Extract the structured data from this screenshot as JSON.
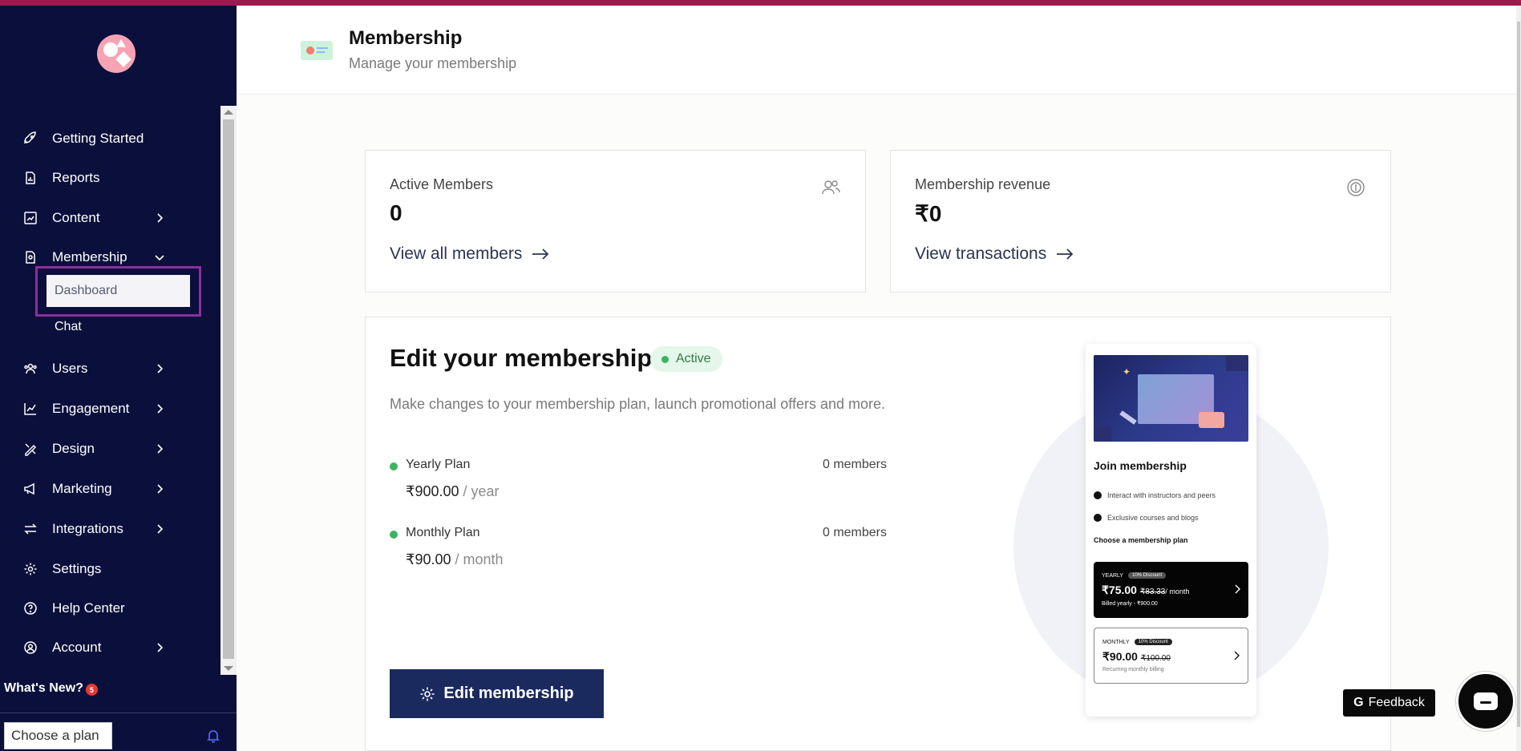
{
  "sidebar": {
    "items": [
      {
        "label": "Getting Started",
        "icon": "rocket-icon"
      },
      {
        "label": "Reports",
        "icon": "report-icon"
      },
      {
        "label": "Content",
        "icon": "content-icon"
      },
      {
        "label": "Membership",
        "icon": "membership-icon"
      },
      {
        "label": "Users",
        "icon": "users-icon"
      },
      {
        "label": "Engagement",
        "icon": "chart-icon"
      },
      {
        "label": "Design",
        "icon": "design-icon"
      },
      {
        "label": "Marketing",
        "icon": "megaphone-icon"
      },
      {
        "label": "Integrations",
        "icon": "arrows-icon"
      },
      {
        "label": "Settings",
        "icon": "gear-icon"
      },
      {
        "label": "Help Center",
        "icon": "help-icon"
      },
      {
        "label": "Account",
        "icon": "account-icon"
      }
    ],
    "membership_sub": {
      "dashboard": "Dashboard",
      "chat": "Chat"
    },
    "whats_new": "What's New?",
    "whats_new_count": "5",
    "plan_select": "Choose a plan"
  },
  "header": {
    "title": "Membership",
    "subtitle": "Manage your membership"
  },
  "stats": {
    "members": {
      "label": "Active Members",
      "value": "0",
      "link": "View all members"
    },
    "revenue": {
      "label": "Membership revenue",
      "value": "₹0",
      "link": "View transactions"
    }
  },
  "edit": {
    "title": "Edit your membership",
    "status": "Active",
    "description": "Make changes to your membership plan, launch promotional offers and more.",
    "plans": [
      {
        "name": "Yearly Plan",
        "members": "0 members",
        "price": "₹900.00",
        "per": " / year"
      },
      {
        "name": "Monthly Plan",
        "members": "0 members",
        "price": "₹90.00",
        "per": " / month"
      }
    ],
    "button": "Edit membership"
  },
  "preview": {
    "title": "Join membership",
    "features": [
      "Interact with instructors and peers",
      "Exclusive courses and blogs"
    ],
    "choose": "Choose a membership plan",
    "yearly": {
      "tag": "YEARLY",
      "discount": "10% Discount",
      "price": "₹75.00",
      "old": "₹83.33",
      "per": "/ month",
      "note": "Billed yearly - ₹900.00"
    },
    "monthly": {
      "tag": "MONTHLY",
      "discount": "10% Discount",
      "price": "₹90.00",
      "old": "₹100.00",
      "note": "Recurring monthly billing"
    }
  },
  "feedback": {
    "label": "Feedback",
    "icon_letter": "G"
  },
  "colors": {
    "sidebar_bg": "#0b0f3b",
    "top_accent": "#9b1b4f",
    "primary_button": "#1a2a5e",
    "active_green": "#3cb362",
    "highlight_frame": "#8e2e9c"
  }
}
